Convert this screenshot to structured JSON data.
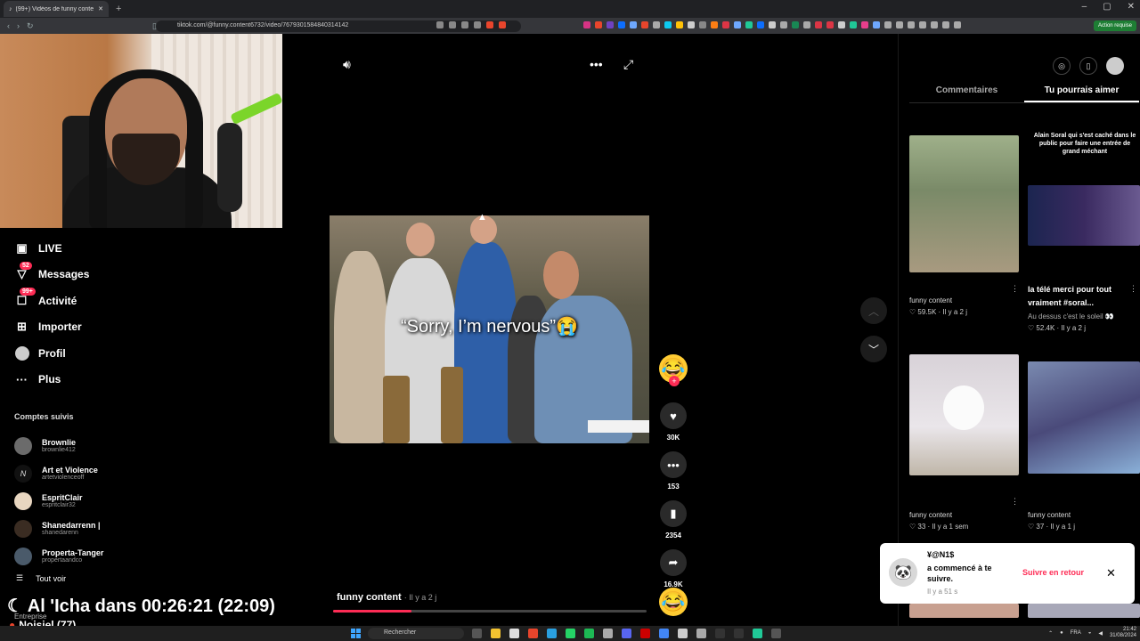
{
  "browser": {
    "tab_title": "(99+) Vidéos de funny conte",
    "url": "tiktok.com/@funny.content6732/video/7679301584840314142",
    "action_button": "Action requise"
  },
  "nav": {
    "items": [
      {
        "label": "LIVE",
        "icon": "live-icon"
      },
      {
        "label": "Messages",
        "icon": "messages-icon",
        "badge": "52"
      },
      {
        "label": "Activité",
        "icon": "activity-icon",
        "badge": "99+"
      },
      {
        "label": "Importer",
        "icon": "upload-icon"
      },
      {
        "label": "Profil",
        "icon": "profile-icon"
      },
      {
        "label": "Plus",
        "icon": "more-icon"
      }
    ],
    "followed_title": "Comptes suivis",
    "followed": [
      {
        "name": "Brownlie",
        "handle": "brownlie412"
      },
      {
        "name": "Art et Violence",
        "handle": "artetviolenceoff"
      },
      {
        "name": "EspritClair",
        "handle": "espritclair32"
      },
      {
        "name": "Shanedarrenn |",
        "handle": "shanedarenn"
      },
      {
        "name": "Properta-Tanger",
        "handle": "propertaandco"
      }
    ],
    "see_all": "Tout voir"
  },
  "overlay": {
    "countdown": "Al 'Icha dans 00:26:21 (22:09)",
    "entreprise": "Entreprise",
    "city": "Noisiel (77)"
  },
  "video": {
    "caption": "“Sorry, I’m nervous”😭",
    "author": "funny content",
    "posted": "· Il y a 2 j",
    "progress": 0.25
  },
  "actions": {
    "likes": "30K",
    "comments": "153",
    "saves": "2354",
    "shares": "16.9K"
  },
  "panel": {
    "tabs": [
      "Commentaires",
      "Tu pourrais aimer"
    ],
    "active_tab": 1,
    "videos": [
      {
        "author": "funny content",
        "likes": "59.5K",
        "time": "Il y a 2 j"
      },
      {
        "overlay": "Alain Soral qui s'est caché dans le public pour faire une entrée de grand méchant",
        "title": "la télé merci pour tout vraiment #soral...",
        "desc": "Au dessus c'est le soleil 👀",
        "likes": "52.4K",
        "time": "Il y a 2 j"
      },
      {
        "author": "funny content",
        "likes": "33",
        "time": "Il y a 1 sem"
      },
      {
        "author": "funny content",
        "likes": "37",
        "time": "Il y a 1 j"
      }
    ]
  },
  "notification": {
    "name": "¥@N1$",
    "message": "a commencé à te suivre.",
    "time": "Il y a 51 s",
    "follow_back": "Suivre en retour"
  },
  "taskbar": {
    "search": "Rechercher",
    "lang": "FRA",
    "time": "21:42",
    "date": "31/08/2024"
  }
}
